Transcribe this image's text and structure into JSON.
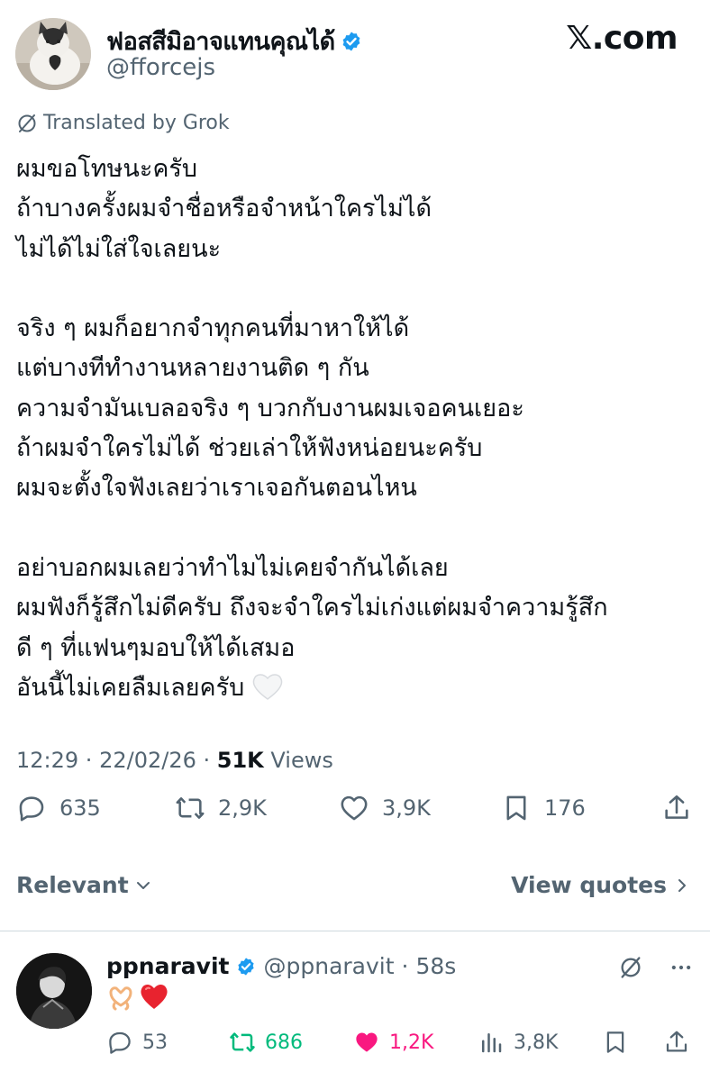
{
  "author": {
    "display_name": "ฟอสสีมิอาจแทนคุณได้",
    "handle": "@fforcejs",
    "avatar_icon": "cat-avatar",
    "verified": true
  },
  "brand": {
    "logo_text": "𝕏.com"
  },
  "translation": {
    "label": "Translated by Grok",
    "icon": "grok-icon"
  },
  "tweet": {
    "lines": [
      "ผมขอโทษนะครับ",
      "ถ้าบางครั้งผมจำชื่อหรือจำหน้าใครไม่ได้",
      "ไม่ได้ไม่ใส่ใจเลยนะ",
      "",
      "จริง ๆ ผมก็อยากจำทุกคนที่มาหาให้ได้",
      "แต่บางทีทำงานหลายงานติด ๆ กัน",
      "ความจำมันเบลอจริง ๆ บวกกับงานผมเจอคนเยอะ",
      "ถ้าผมจำใครไม่ได้ ช่วยเล่าให้ฟังหน่อยนะครับ",
      "ผมจะตั้งใจฟังเลยว่าเราเจอกันตอนไหน",
      "",
      "อย่าบอกผมเลยว่าทำไมไม่เคยจำกันได้เลย",
      "ผมฟังก็รู้สึกไม่ดีครับ ถึงจะจำใครไม่เก่งแต่ผมจำความรู้สึก",
      "ดี ๆ ที่แฟนๆมอบให้ได้เสมอ",
      "อันนี้ไม่เคยลืมเลยครับ"
    ],
    "end_emoji": "white-heart-emoji",
    "time": "12:29",
    "date": "22/02/26",
    "views_count": "51K",
    "views_label": "Views"
  },
  "stats": {
    "replies": "635",
    "reposts": "2,9K",
    "likes": "3,9K",
    "bookmarks": "176"
  },
  "filters": {
    "sort_label": "Relevant",
    "quotes_label": "View quotes"
  },
  "reply": {
    "display_name": "ppnaravit",
    "handle": "@ppnaravit",
    "age": "58s",
    "emojis": [
      "heart-hands-emoji",
      "red-heart-emoji"
    ],
    "stats": {
      "replies": "53",
      "reposts": "686",
      "likes": "1,2K",
      "views": "3,8K"
    }
  },
  "colors": {
    "text": "#0f1419",
    "muted": "#536471",
    "verified": "#1d9bf0",
    "repost_active": "#00ba7c",
    "like_active": "#f91880"
  }
}
